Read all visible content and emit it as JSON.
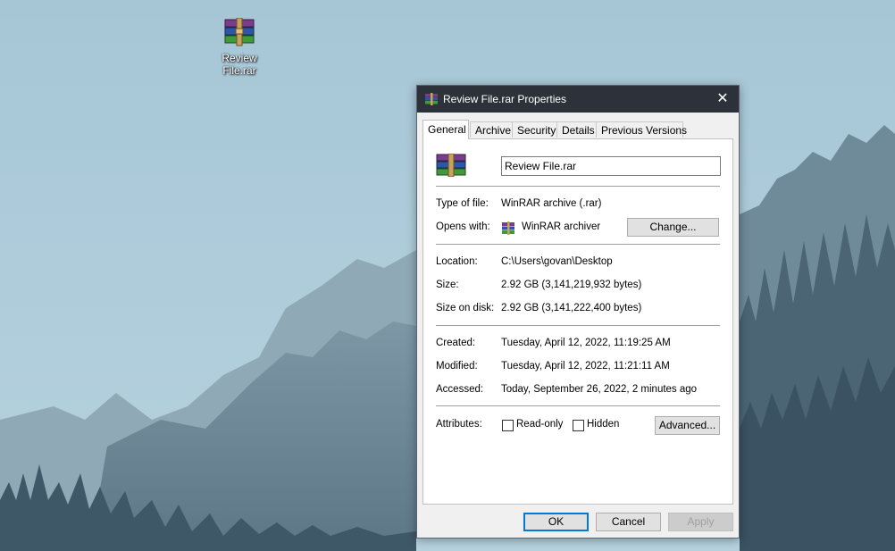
{
  "desktop": {
    "icon_label_line1": "Review",
    "icon_label_line2": "File.rar"
  },
  "dialog": {
    "title": "Review File.rar Properties",
    "close_glyph": "✕",
    "tabs": [
      {
        "label": "General",
        "active": true
      },
      {
        "label": "Archive",
        "active": false
      },
      {
        "label": "Security",
        "active": false
      },
      {
        "label": "Details",
        "active": false
      },
      {
        "label": "Previous Versions",
        "active": false
      }
    ],
    "general": {
      "file_name": "Review File.rar",
      "type_label": "Type of file:",
      "type_value": "WinRAR archive (.rar)",
      "opens_label": "Opens with:",
      "opens_value": "WinRAR archiver",
      "change_button": "Change...",
      "location_label": "Location:",
      "location_value": "C:\\Users\\govan\\Desktop",
      "size_label": "Size:",
      "size_value": "2.92 GB (3,141,219,932 bytes)",
      "size_on_disk_label": "Size on disk:",
      "size_on_disk_value": "2.92 GB (3,141,222,400 bytes)",
      "created_label": "Created:",
      "created_value": "Tuesday, April 12, 2022, 11:19:25 AM",
      "modified_label": "Modified:",
      "modified_value": "Tuesday, April 12, 2022, 11:21:11 AM",
      "accessed_label": "Accessed:",
      "accessed_value": "Today, September 26, 2022, 2 minutes ago",
      "attributes_label": "Attributes:",
      "readonly_label": "Read-only",
      "readonly_checked": false,
      "hidden_label": "Hidden",
      "hidden_checked": false,
      "advanced_button": "Advanced..."
    },
    "buttons": {
      "ok": "OK",
      "cancel": "Cancel",
      "apply": "Apply"
    }
  },
  "colors": {
    "titlebar": "#2d3139",
    "accent": "#0078d7",
    "sky": "#a9cadb"
  },
  "icons": [
    "winrar-archive-icon",
    "close-icon",
    "checkbox-icon"
  ]
}
